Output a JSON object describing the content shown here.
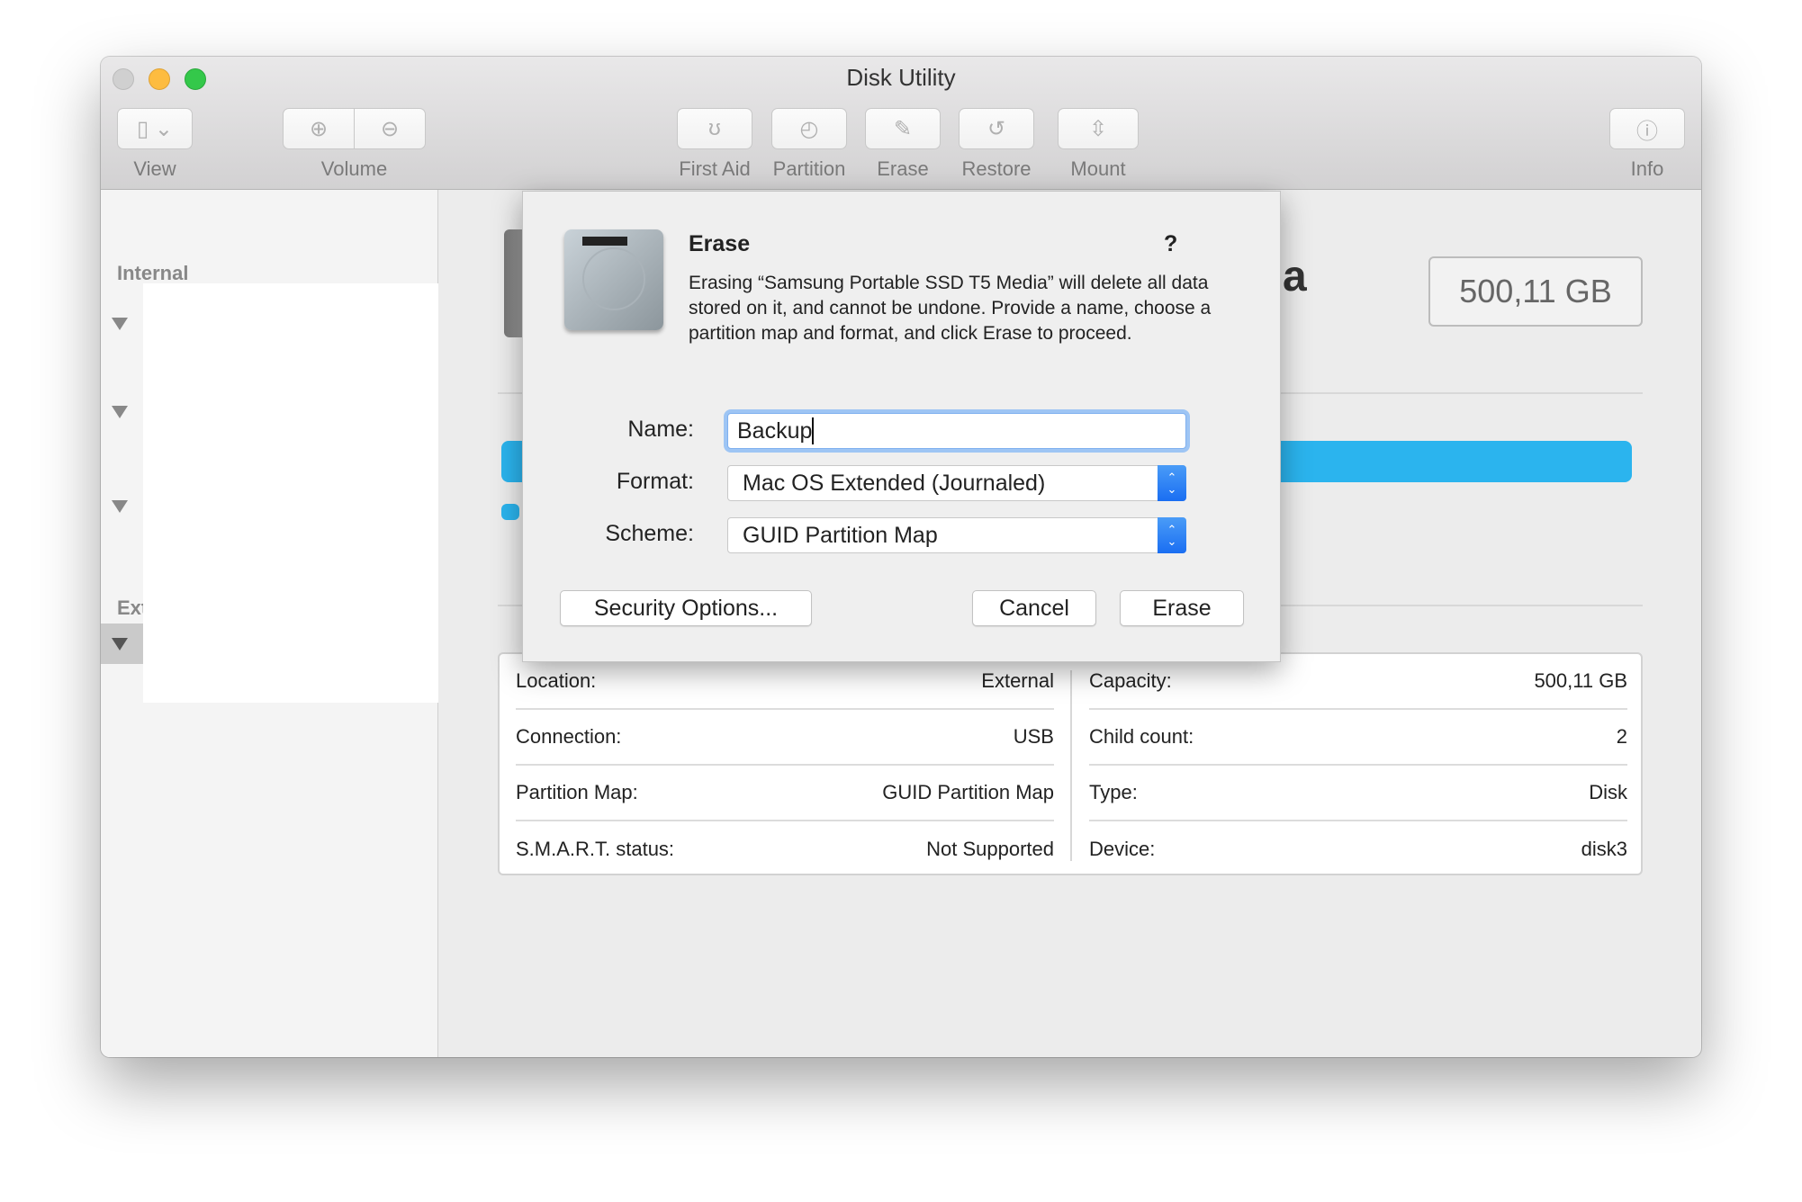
{
  "window": {
    "title": "Disk Utility",
    "traffic_colors": [
      "#d0d0d0",
      "#fdbc40",
      "#34c84a"
    ]
  },
  "toolbar": {
    "view": "View",
    "volume": "Volume",
    "first_aid": "First Aid",
    "partition": "Partition",
    "erase": "Erase",
    "restore": "Restore",
    "mount": "Mount",
    "info": "Info"
  },
  "sidebar": {
    "internal": "Internal",
    "external": "External"
  },
  "main": {
    "name_fragment": "a",
    "capacity": "500,11 GB",
    "accent": "#2bb4ee"
  },
  "info": {
    "left": [
      {
        "k": "Location:",
        "v": "External"
      },
      {
        "k": "Connection:",
        "v": "USB"
      },
      {
        "k": "Partition Map:",
        "v": "GUID Partition Map"
      },
      {
        "k": "S.M.A.R.T. status:",
        "v": "Not Supported"
      }
    ],
    "right": [
      {
        "k": "Capacity:",
        "v": "500,11 GB"
      },
      {
        "k": "Child count:",
        "v": "2"
      },
      {
        "k": "Type:",
        "v": "Disk"
      },
      {
        "k": "Device:",
        "v": "disk3"
      }
    ]
  },
  "dialog": {
    "title": "Erase",
    "help": "?",
    "message": "Erasing “Samsung Portable SSD T5 Media” will delete all data stored on it, and cannot be undone. Provide a name, choose a partition map and format, and click Erase to proceed.",
    "name_label": "Name:",
    "name_value": "Backup",
    "format_label": "Format:",
    "format_value": "Mac OS Extended (Journaled)",
    "scheme_label": "Scheme:",
    "scheme_value": "GUID Partition Map",
    "security": "Security Options...",
    "cancel": "Cancel",
    "erase": "Erase"
  }
}
